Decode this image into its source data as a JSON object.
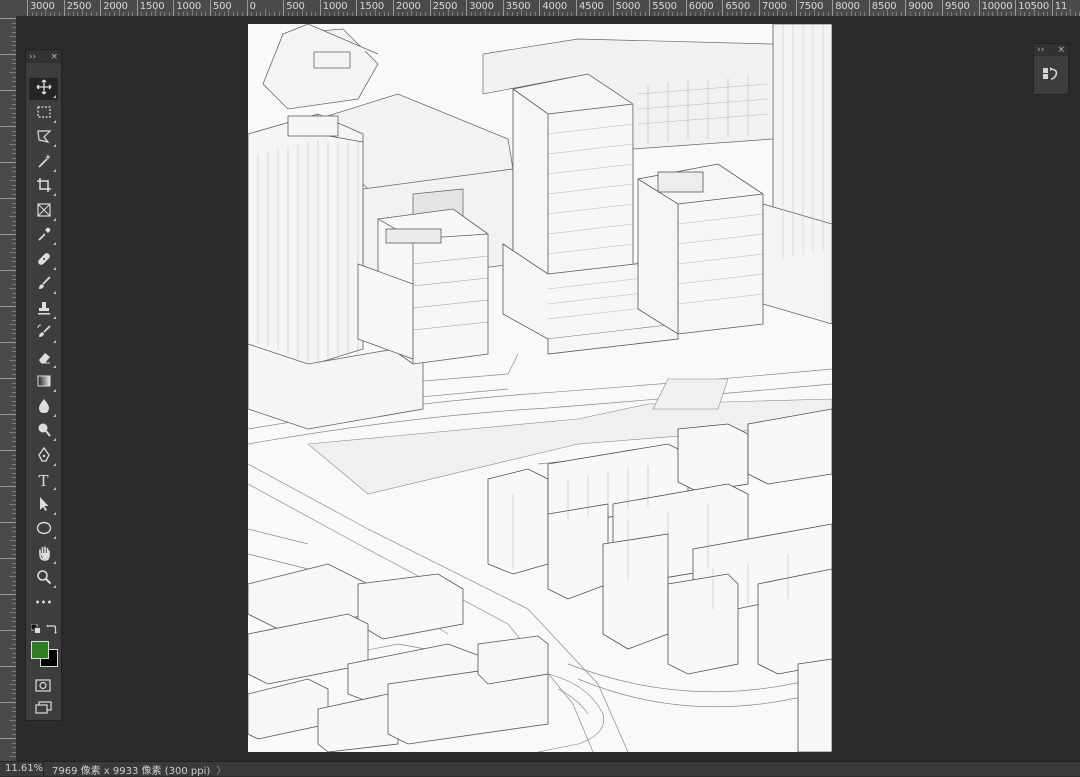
{
  "ruler": {
    "labels": [
      "3000",
      "2500",
      "2000",
      "1500",
      "1000",
      "500",
      "0",
      "500",
      "1000",
      "1500",
      "2000",
      "2500",
      "3000",
      "3500",
      "4000",
      "4500",
      "5000",
      "5500",
      "6000",
      "6500",
      "7000",
      "7500",
      "8000",
      "8500",
      "9000",
      "9500",
      "10000",
      "10500",
      "11"
    ]
  },
  "tools_panel": {
    "collapse_glyph": "››",
    "close_glyph": "×",
    "tools": [
      {
        "name": "move-tool",
        "icon": "move-icon",
        "active": true
      },
      {
        "name": "rectangular-marquee-tool",
        "icon": "marquee-icon"
      },
      {
        "name": "lasso-tool",
        "icon": "polygonal-lasso-icon"
      },
      {
        "name": "magic-wand-tool",
        "icon": "magic-wand-icon"
      },
      {
        "name": "crop-tool",
        "icon": "crop-icon"
      },
      {
        "name": "frame-tool",
        "icon": "frame-icon"
      },
      {
        "name": "eyedropper-tool",
        "icon": "eyedropper-icon"
      },
      {
        "name": "healing-brush-tool",
        "icon": "bandage-icon"
      },
      {
        "name": "brush-tool",
        "icon": "brush-icon"
      },
      {
        "name": "clone-stamp-tool",
        "icon": "stamp-icon"
      },
      {
        "name": "history-brush-tool",
        "icon": "history-brush-icon"
      },
      {
        "name": "eraser-tool",
        "icon": "eraser-icon"
      },
      {
        "name": "gradient-tool",
        "icon": "gradient-icon"
      },
      {
        "name": "blur-tool",
        "icon": "blur-drop-icon"
      },
      {
        "name": "dodge-tool",
        "icon": "dodge-icon"
      },
      {
        "name": "pen-tool",
        "icon": "pen-icon"
      },
      {
        "name": "type-tool",
        "icon": "type-icon",
        "glyph": "T"
      },
      {
        "name": "path-selection-tool",
        "icon": "arrow-icon"
      },
      {
        "name": "ellipse-tool",
        "icon": "ellipse-icon"
      },
      {
        "name": "hand-tool",
        "icon": "hand-icon"
      },
      {
        "name": "zoom-tool",
        "icon": "magnifier-icon"
      },
      {
        "name": "edit-toolbar",
        "icon": "more-icon",
        "glyph": "•••"
      }
    ],
    "foreground_color": "#2e7d1f",
    "background_color": "#000000"
  },
  "right_panel": {
    "collapse_glyph": "››",
    "close_glyph": "×",
    "icon": "history-panel-icon"
  },
  "status_bar": {
    "zoom": "11.61%",
    "doc_info": "7969 像素 x 9933 像素 (300 ppi)",
    "arrow": "〉"
  }
}
